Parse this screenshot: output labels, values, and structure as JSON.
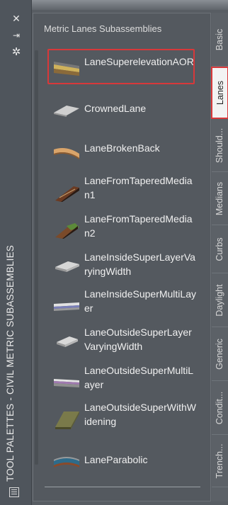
{
  "palette": {
    "side_title": "TOOL PALETTES - CIVIL METRIC SUBASSEMBLIES",
    "header": "Metric Lanes Subassemblies",
    "icons": {
      "close": "close-icon",
      "auto_hide": "auto-hide-icon",
      "properties": "properties-gear-icon",
      "palette_menu": "palette-menu-icon"
    }
  },
  "items": [
    {
      "label": "LaneSuperelevationAOR",
      "icon": "lane-superelevation-thumb"
    },
    {
      "label": "CrownedLane",
      "icon": "crowned-lane-thumb"
    },
    {
      "label": "LaneBrokenBack",
      "icon": "lane-brokenback-thumb"
    },
    {
      "label": "LaneFromTaperedMedian1",
      "icon": "lane-tapered-median1-thumb"
    },
    {
      "label": "LaneFromTaperedMedian2",
      "icon": "lane-tapered-median2-thumb"
    },
    {
      "label": "LaneInsideSuperLayerVaryingWidth",
      "icon": "lane-inside-super-layer-thumb"
    },
    {
      "label": "LaneInsideSuperMultiLayer",
      "icon": "lane-inside-super-multilayer-thumb"
    },
    {
      "label": "LaneOutsideSuperLayerVaryingWidth",
      "icon": "lane-outside-super-layer-thumb"
    },
    {
      "label": "LaneOutsideSuperMultiLayer",
      "icon": "lane-outside-super-multilayer-thumb"
    },
    {
      "label": "LaneOutsideSuperWithWidening",
      "icon": "lane-outside-super-widening-thumb"
    },
    {
      "label": "LaneParabolic",
      "icon": "lane-parabolic-thumb"
    }
  ],
  "tabs": [
    {
      "label": "Basic"
    },
    {
      "label": "Lanes",
      "active": true
    },
    {
      "label": "Should..."
    },
    {
      "label": "Medians"
    },
    {
      "label": "Curbs"
    },
    {
      "label": "Daylight"
    },
    {
      "label": "Generic"
    },
    {
      "label": "Condit..."
    },
    {
      "label": "Trench..."
    }
  ],
  "colors": {
    "selection": "#d8383a",
    "panel_bg": "#54595f",
    "text": "#f0f0f0"
  }
}
